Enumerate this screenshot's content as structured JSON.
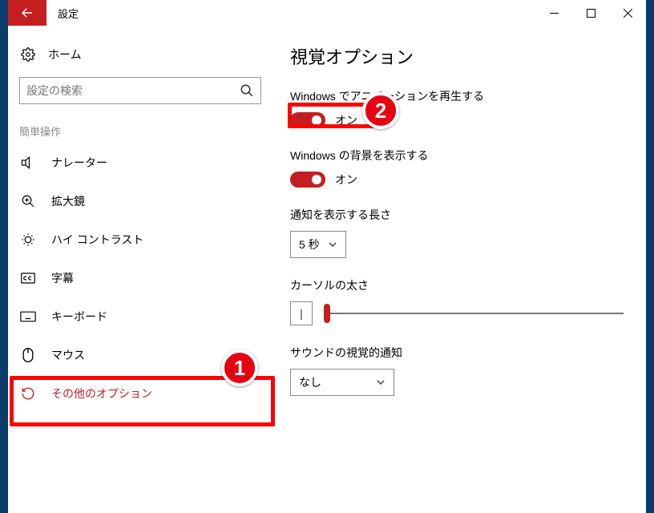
{
  "titlebar": {
    "title": "設定"
  },
  "sidebar": {
    "home": "ホーム",
    "search_placeholder": "設定の検索",
    "section": "簡単操作",
    "items": [
      {
        "label": "ナレーター"
      },
      {
        "label": "拡大鏡"
      },
      {
        "label": "ハイ コントラスト"
      },
      {
        "label": "字幕"
      },
      {
        "label": "キーボード"
      },
      {
        "label": "マウス"
      },
      {
        "label": "その他のオプション"
      }
    ]
  },
  "content": {
    "heading": "視覚オプション",
    "anim": {
      "label": "Windows でアニメーションを再生する",
      "state": "オン"
    },
    "bg": {
      "label": "Windows の背景を表示する",
      "state": "オン"
    },
    "notify": {
      "label": "通知を表示する長さ",
      "value": "5 秒"
    },
    "cursor": {
      "label": "カーソルの太さ"
    },
    "soundvis": {
      "label": "サウンドの視覚的通知",
      "value": "なし"
    }
  },
  "annotations": {
    "badge1": "1",
    "badge2": "2"
  }
}
